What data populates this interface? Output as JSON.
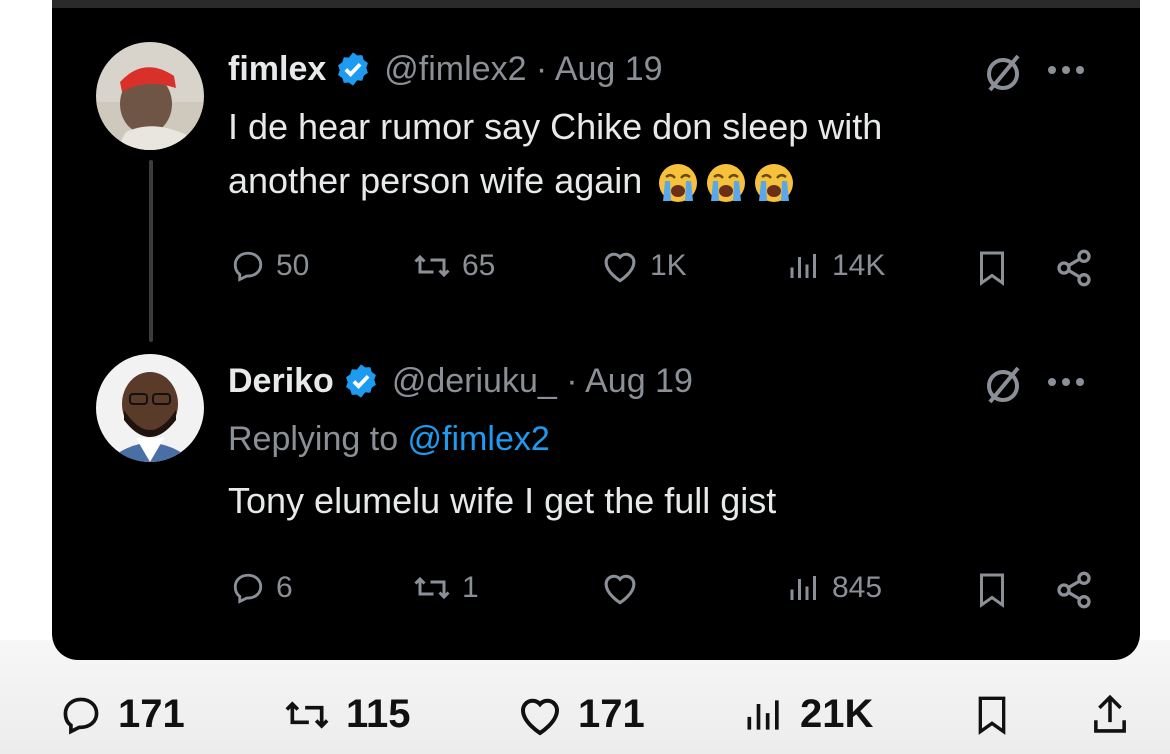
{
  "tweet1": {
    "name": "fimlex",
    "handle": "@fimlex2 · Aug 19",
    "text": "I de hear rumor say Chike don sleep with another person wife again",
    "emoji_icons": [
      "loudly-crying-face-icon",
      "loudly-crying-face-icon",
      "loudly-crying-face-icon"
    ],
    "replies": "50",
    "reposts": "65",
    "likes": "1K",
    "views": "14K"
  },
  "tweet2": {
    "name": "Deriko",
    "handle": "@deriuku_ · Aug 19",
    "replying_prefix": "Replying to ",
    "replying_mention": "@fimlex2",
    "text": "Tony elumelu wife I get the full gist",
    "replies": "6",
    "reposts": "1",
    "likes": "",
    "views": "845"
  },
  "outer": {
    "replies": "171",
    "reposts": "115",
    "likes": "171",
    "views": "21K"
  },
  "colors": {
    "card_bg": "#000000",
    "text": "#e7e9ea",
    "muted": "#8b9096",
    "link": "#1d9bf0",
    "verified": "#1d9bf0"
  }
}
